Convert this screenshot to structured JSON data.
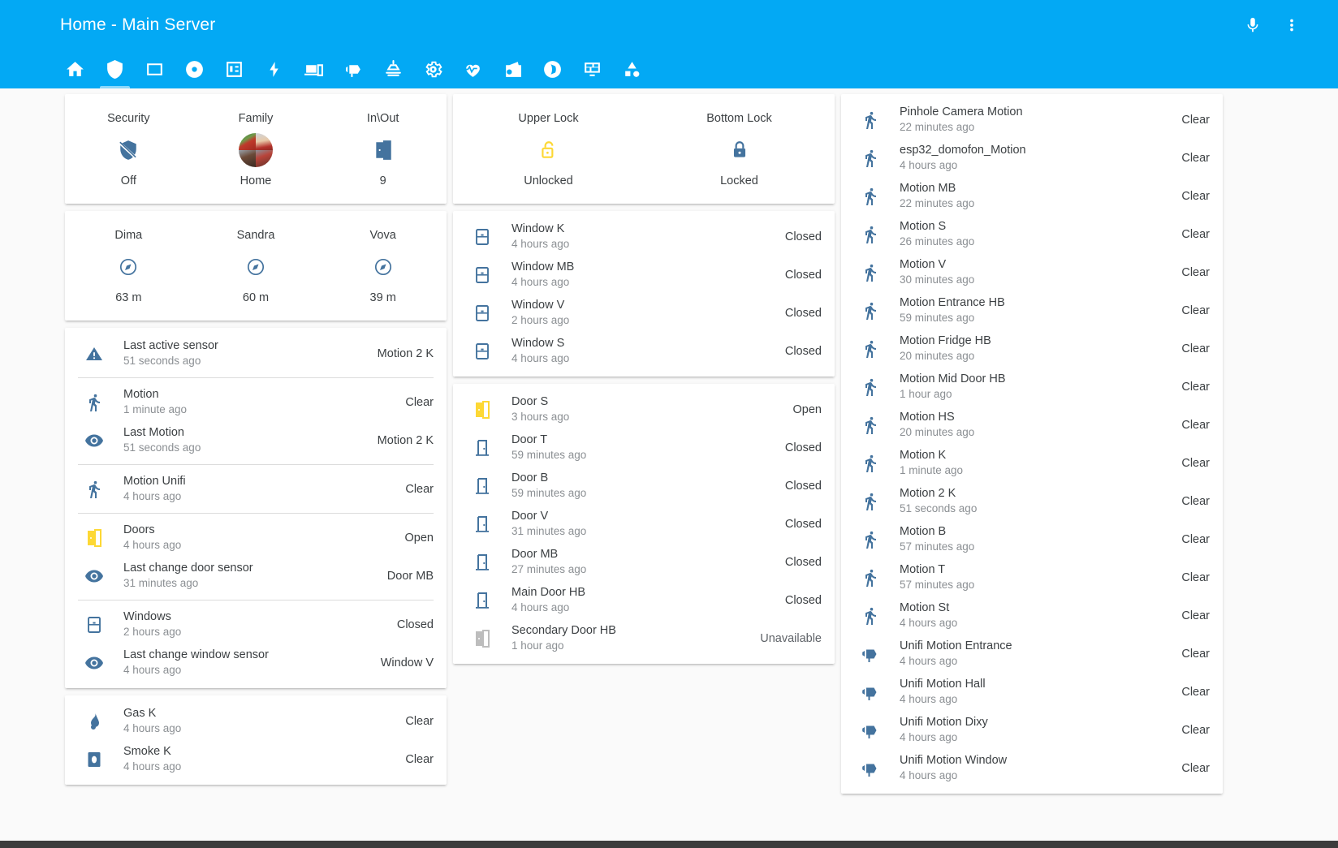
{
  "header": {
    "title": "Home - Main Server",
    "actions": [
      {
        "name": "microphone-icon",
        "label": "Assist"
      },
      {
        "name": "overflow-menu-icon",
        "label": "Menu"
      }
    ],
    "tabs": [
      {
        "name": "tab-home",
        "icon": "home",
        "active": false
      },
      {
        "name": "tab-security",
        "icon": "shield",
        "active": true
      },
      {
        "name": "tab-rooms",
        "icon": "square",
        "active": false
      },
      {
        "name": "tab-vacuum",
        "icon": "disc",
        "active": false
      },
      {
        "name": "tab-calendar",
        "icon": "calendar",
        "active": false
      },
      {
        "name": "tab-energy",
        "icon": "lightning",
        "active": false
      },
      {
        "name": "tab-devices",
        "icon": "devices",
        "active": false
      },
      {
        "name": "tab-cameras",
        "icon": "cctv",
        "active": false
      },
      {
        "name": "tab-lights",
        "icon": "ceiling-light",
        "active": false
      },
      {
        "name": "tab-settings",
        "icon": "gear",
        "active": false
      },
      {
        "name": "tab-health",
        "icon": "heart-pulse",
        "active": false
      },
      {
        "name": "tab-media",
        "icon": "radio",
        "active": false
      },
      {
        "name": "tab-audio",
        "icon": "headphones",
        "active": false
      },
      {
        "name": "tab-system",
        "icon": "monitor-dashboard",
        "active": false
      },
      {
        "name": "tab-shapes",
        "icon": "shapes",
        "active": false
      }
    ]
  },
  "left_column": {
    "glance_security": [
      {
        "name": "Security",
        "state": "Off",
        "icon": "shield-off",
        "color": "blue"
      },
      {
        "name": "Family",
        "state": "Home",
        "icon": "avatar-group",
        "color": "photo"
      },
      {
        "name": "In\\Out",
        "state": "9",
        "icon": "door-open",
        "color": "blue"
      }
    ],
    "glance_people": [
      {
        "name": "Dima",
        "state": "63 m",
        "icon": "compass",
        "color": "blue"
      },
      {
        "name": "Sandra",
        "state": "60 m",
        "icon": "compass",
        "color": "blue"
      },
      {
        "name": "Vova",
        "state": "39 m",
        "icon": "compass",
        "color": "blue"
      }
    ],
    "sensors": [
      {
        "name": "Last active sensor",
        "sub": "51 seconds ago",
        "state": "Motion 2 K",
        "icon": "alert",
        "color": "blue",
        "divider_after": true
      },
      {
        "name": "Motion",
        "sub": "1 minute ago",
        "state": "Clear",
        "icon": "walk",
        "color": "blue",
        "divider_after": false
      },
      {
        "name": "Last Motion",
        "sub": "51 seconds ago",
        "state": "Motion 2 K",
        "icon": "eye",
        "color": "blue",
        "divider_after": true
      },
      {
        "name": "Motion Unifi",
        "sub": "4 hours ago",
        "state": "Clear",
        "icon": "walk",
        "color": "blue",
        "divider_after": true
      },
      {
        "name": "Doors",
        "sub": "4 hours ago",
        "state": "Open",
        "icon": "door-open",
        "color": "amber",
        "divider_after": false
      },
      {
        "name": "Last change door sensor",
        "sub": "31 minutes ago",
        "state": "Door MB",
        "icon": "eye",
        "color": "blue",
        "divider_after": true
      },
      {
        "name": "Windows",
        "sub": "2 hours ago",
        "state": "Closed",
        "icon": "window-closed",
        "color": "blue",
        "divider_after": false
      },
      {
        "name": "Last change window sensor",
        "sub": "4 hours ago",
        "state": "Window V",
        "icon": "eye",
        "color": "blue",
        "divider_after": false
      }
    ],
    "alarms": [
      {
        "name": "Gas K",
        "sub": "4 hours ago",
        "state": "Clear",
        "icon": "gas",
        "color": "blue"
      },
      {
        "name": "Smoke K",
        "sub": "4 hours ago",
        "state": "Clear",
        "icon": "smoke",
        "color": "blue"
      }
    ]
  },
  "middle_column": {
    "glance_locks": [
      {
        "name": "Upper Lock",
        "state": "Unlocked",
        "icon": "lock-open",
        "color": "amber"
      },
      {
        "name": "Bottom Lock",
        "state": "Locked",
        "icon": "lock",
        "color": "blue"
      }
    ],
    "windows": [
      {
        "name": "Window K",
        "sub": "4 hours ago",
        "state": "Closed",
        "icon": "window-closed",
        "color": "blue"
      },
      {
        "name": "Window MB",
        "sub": "4 hours ago",
        "state": "Closed",
        "icon": "window-closed",
        "color": "blue"
      },
      {
        "name": "Window V",
        "sub": "2 hours ago",
        "state": "Closed",
        "icon": "window-closed",
        "color": "blue"
      },
      {
        "name": "Window S",
        "sub": "4 hours ago",
        "state": "Closed",
        "icon": "window-closed",
        "color": "blue"
      }
    ],
    "doors": [
      {
        "name": "Door S",
        "sub": "3 hours ago",
        "state": "Open",
        "icon": "door-open",
        "color": "amber"
      },
      {
        "name": "Door T",
        "sub": "59 minutes ago",
        "state": "Closed",
        "icon": "door-closed",
        "color": "blue"
      },
      {
        "name": "Door B",
        "sub": "59 minutes ago",
        "state": "Closed",
        "icon": "door-closed",
        "color": "blue"
      },
      {
        "name": "Door V",
        "sub": "31 minutes ago",
        "state": "Closed",
        "icon": "door-closed",
        "color": "blue"
      },
      {
        "name": "Door MB",
        "sub": "27 minutes ago",
        "state": "Closed",
        "icon": "door-closed",
        "color": "blue"
      },
      {
        "name": "Main Door HB",
        "sub": "4 hours ago",
        "state": "Closed",
        "icon": "door-closed",
        "color": "blue"
      },
      {
        "name": "Secondary Door HB",
        "sub": "1 hour ago",
        "state": "Unavailable",
        "icon": "door-open",
        "color": "grey"
      }
    ]
  },
  "right_column": {
    "motions": [
      {
        "name": "Pinhole Camera Motion",
        "sub": "22 minutes ago",
        "state": "Clear",
        "icon": "walk"
      },
      {
        "name": "esp32_domofon_Motion",
        "sub": "4 hours ago",
        "state": "Clear",
        "icon": "walk"
      },
      {
        "name": "Motion MB",
        "sub": "22 minutes ago",
        "state": "Clear",
        "icon": "walk"
      },
      {
        "name": "Motion S",
        "sub": "26 minutes ago",
        "state": "Clear",
        "icon": "walk"
      },
      {
        "name": "Motion V",
        "sub": "30 minutes ago",
        "state": "Clear",
        "icon": "walk"
      },
      {
        "name": "Motion Entrance HB",
        "sub": "59 minutes ago",
        "state": "Clear",
        "icon": "walk"
      },
      {
        "name": "Motion Fridge HB",
        "sub": "20 minutes ago",
        "state": "Clear",
        "icon": "walk"
      },
      {
        "name": "Motion Mid Door HB",
        "sub": "1 hour ago",
        "state": "Clear",
        "icon": "walk"
      },
      {
        "name": "Motion HS",
        "sub": "20 minutes ago",
        "state": "Clear",
        "icon": "walk"
      },
      {
        "name": "Motion K",
        "sub": "1 minute ago",
        "state": "Clear",
        "icon": "walk"
      },
      {
        "name": "Motion 2 K",
        "sub": "51 seconds ago",
        "state": "Clear",
        "icon": "walk"
      },
      {
        "name": "Motion B",
        "sub": "57 minutes ago",
        "state": "Clear",
        "icon": "walk"
      },
      {
        "name": "Motion T",
        "sub": "57 minutes ago",
        "state": "Clear",
        "icon": "walk"
      },
      {
        "name": "Motion St",
        "sub": "4 hours ago",
        "state": "Clear",
        "icon": "walk"
      },
      {
        "name": "Unifi Motion Entrance",
        "sub": "4 hours ago",
        "state": "Clear",
        "icon": "cctv"
      },
      {
        "name": "Unifi Motion Hall",
        "sub": "4 hours ago",
        "state": "Clear",
        "icon": "cctv"
      },
      {
        "name": "Unifi Motion Dixy",
        "sub": "4 hours ago",
        "state": "Clear",
        "icon": "cctv"
      },
      {
        "name": "Unifi Motion Window",
        "sub": "4 hours ago",
        "state": "Clear",
        "icon": "cctv"
      }
    ]
  },
  "colors": {
    "accent": "#03a9f4",
    "icon_blue": "#44739e",
    "icon_amber": "#fdd835",
    "icon_grey": "#bdbdbd",
    "text_primary": "#3c4043",
    "text_secondary": "#8b8f93",
    "page_background": "#fafafa"
  }
}
